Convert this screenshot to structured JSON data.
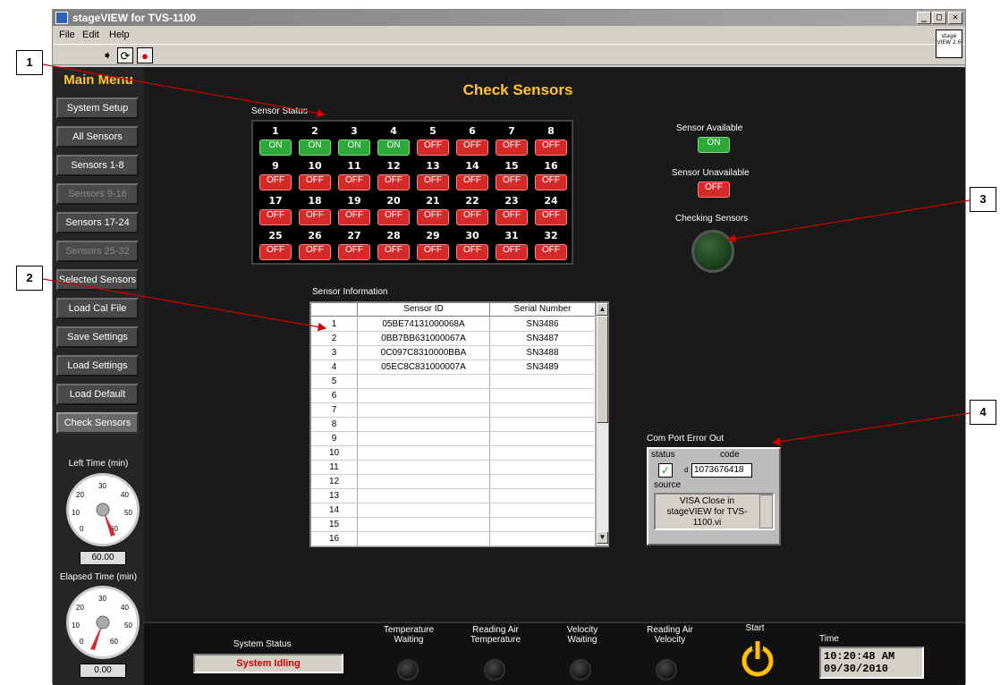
{
  "window": {
    "title": "stageVIEW for TVS-1100",
    "minimize": "_",
    "maximize": "□",
    "close": "✕"
  },
  "menu": {
    "file": "File",
    "edit": "Edit",
    "help": "Help"
  },
  "toolbar": {
    "run": "➧",
    "run_continuous": "⟳",
    "abort": "●"
  },
  "version_logo": "stage VIEW 2.6",
  "left_menu": {
    "title": "Main Menu",
    "items": [
      {
        "label": "System Setup",
        "enabled": true
      },
      {
        "label": "All Sensors",
        "enabled": true
      },
      {
        "label": "Sensors 1-8",
        "enabled": true
      },
      {
        "label": "Sensors 9-16",
        "enabled": false
      },
      {
        "label": "Sensors 17-24",
        "enabled": true
      },
      {
        "label": "Sensors 25-32",
        "enabled": false
      },
      {
        "label": "Selected  Sensors",
        "enabled": true
      },
      {
        "label": "Load Cal File",
        "enabled": true
      },
      {
        "label": "Save Settings",
        "enabled": true
      },
      {
        "label": "Load Settings",
        "enabled": true
      },
      {
        "label": "Load Default",
        "enabled": true
      },
      {
        "label": "Check Sensors",
        "enabled": true,
        "active": true
      }
    ]
  },
  "left_time": {
    "label": "Left Time (min)",
    "value": "60.00",
    "ticks": [
      "0",
      "10",
      "20",
      "30",
      "40",
      "50",
      "60"
    ]
  },
  "elapsed_time": {
    "label": "Elapsed Time (min)",
    "value": "0.00",
    "ticks": [
      "0",
      "10",
      "20",
      "30",
      "40",
      "50",
      "60"
    ]
  },
  "page_title": "Check Sensors",
  "sensor_status": {
    "label": "Sensor Status",
    "on_text": "ON",
    "off_text": "OFF",
    "sensors": [
      {
        "n": "1",
        "on": true
      },
      {
        "n": "2",
        "on": true
      },
      {
        "n": "3",
        "on": true
      },
      {
        "n": "4",
        "on": true
      },
      {
        "n": "5",
        "on": false
      },
      {
        "n": "6",
        "on": false
      },
      {
        "n": "7",
        "on": false
      },
      {
        "n": "8",
        "on": false
      },
      {
        "n": "9",
        "on": false
      },
      {
        "n": "10",
        "on": false
      },
      {
        "n": "11",
        "on": false
      },
      {
        "n": "12",
        "on": false
      },
      {
        "n": "13",
        "on": false
      },
      {
        "n": "14",
        "on": false
      },
      {
        "n": "15",
        "on": false
      },
      {
        "n": "16",
        "on": false
      },
      {
        "n": "17",
        "on": false
      },
      {
        "n": "18",
        "on": false
      },
      {
        "n": "19",
        "on": false
      },
      {
        "n": "20",
        "on": false
      },
      {
        "n": "21",
        "on": false
      },
      {
        "n": "22",
        "on": false
      },
      {
        "n": "23",
        "on": false
      },
      {
        "n": "24",
        "on": false
      },
      {
        "n": "25",
        "on": false
      },
      {
        "n": "26",
        "on": false
      },
      {
        "n": "27",
        "on": false
      },
      {
        "n": "28",
        "on": false
      },
      {
        "n": "29",
        "on": false
      },
      {
        "n": "30",
        "on": false
      },
      {
        "n": "31",
        "on": false
      },
      {
        "n": "32",
        "on": false
      }
    ]
  },
  "legend": {
    "available_label": "Sensor Available",
    "available_led": "ON",
    "unavailable_label": "Sensor Unavailable",
    "unavailable_led": "OFF",
    "checking_label": "Checking Sensors"
  },
  "sensor_info": {
    "label": "Sensor Information",
    "columns": [
      "",
      "Sensor ID",
      "Serial Number"
    ],
    "rows": [
      [
        "1",
        "05BE74131000068A",
        "SN3486"
      ],
      [
        "2",
        "0BB7BB631000067A",
        "SN3487"
      ],
      [
        "3",
        "0C097C8310000BBA",
        "SN3488"
      ],
      [
        "4",
        "05EC8C831000007A",
        "SN3489"
      ],
      [
        "5",
        "",
        ""
      ],
      [
        "6",
        "",
        ""
      ],
      [
        "7",
        "",
        ""
      ],
      [
        "8",
        "",
        ""
      ],
      [
        "9",
        "",
        ""
      ],
      [
        "10",
        "",
        ""
      ],
      [
        "11",
        "",
        ""
      ],
      [
        "12",
        "",
        ""
      ],
      [
        "13",
        "",
        ""
      ],
      [
        "14",
        "",
        ""
      ],
      [
        "15",
        "",
        ""
      ],
      [
        "16",
        "",
        ""
      ]
    ]
  },
  "error_out": {
    "label": "Com Port Error Out",
    "status_label": "status",
    "code_label": "code",
    "code_prefix": "d",
    "code": "1073676418",
    "status_check": "✓",
    "source_label": "source",
    "source": "VISA Close in stageVIEW for TVS-1100.vi"
  },
  "bottom": {
    "system_status_label": "System Status",
    "system_status": "System Idling",
    "temp_waiting": "Temperature Waiting",
    "reading_air_temp": "Reading Air Temperature",
    "velocity_waiting": "Velocity Waiting",
    "reading_air_velocity": "Reading Air Velocity",
    "start_label": "Start",
    "time_label": "Time",
    "time": "10:20:48 AM",
    "date": "09/30/2010"
  },
  "callouts": [
    "1",
    "2",
    "3",
    "4"
  ],
  "colors": {
    "accent": "#ffc52a",
    "on": "#2ea83a",
    "off": "#d62a2a",
    "status_text": "#d00000"
  }
}
